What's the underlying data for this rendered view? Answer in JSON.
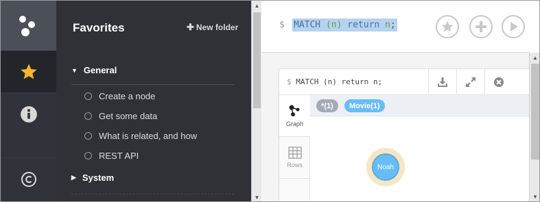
{
  "rail": {
    "icons": [
      "logo-icon",
      "star-icon",
      "info-icon",
      "copyright-icon"
    ],
    "active_color": "#f8b62c"
  },
  "favorites": {
    "title": "Favorites",
    "new_folder_label": "New folder",
    "sections": [
      {
        "label": "General",
        "expanded": true,
        "items": [
          {
            "label": "Create a node"
          },
          {
            "label": "Get some data"
          },
          {
            "label": "What is related, and how"
          },
          {
            "label": "REST API"
          }
        ]
      },
      {
        "label": "System",
        "expanded": false
      }
    ]
  },
  "editor": {
    "prompt": "$",
    "query_keyword_match": "MATCH",
    "query_pattern": "(n)",
    "query_keyword_return": "return",
    "query_var": "n",
    "query_end": ";",
    "buttons": [
      "star-icon",
      "plus-icon",
      "play-icon"
    ]
  },
  "result": {
    "prompt": "$",
    "query": "MATCH (n) return n;",
    "actions": [
      "download-icon",
      "expand-icon",
      "close-icon"
    ],
    "tabs": [
      {
        "label": "Graph",
        "active": true
      },
      {
        "label": "Rows",
        "active": false
      }
    ],
    "labels": [
      {
        "text": "*(1)",
        "color": "#a5abb6"
      },
      {
        "text": "Movie(1)",
        "color": "#68bdf6"
      }
    ],
    "node": {
      "caption": "Noah",
      "color": "#68bdf6"
    }
  }
}
